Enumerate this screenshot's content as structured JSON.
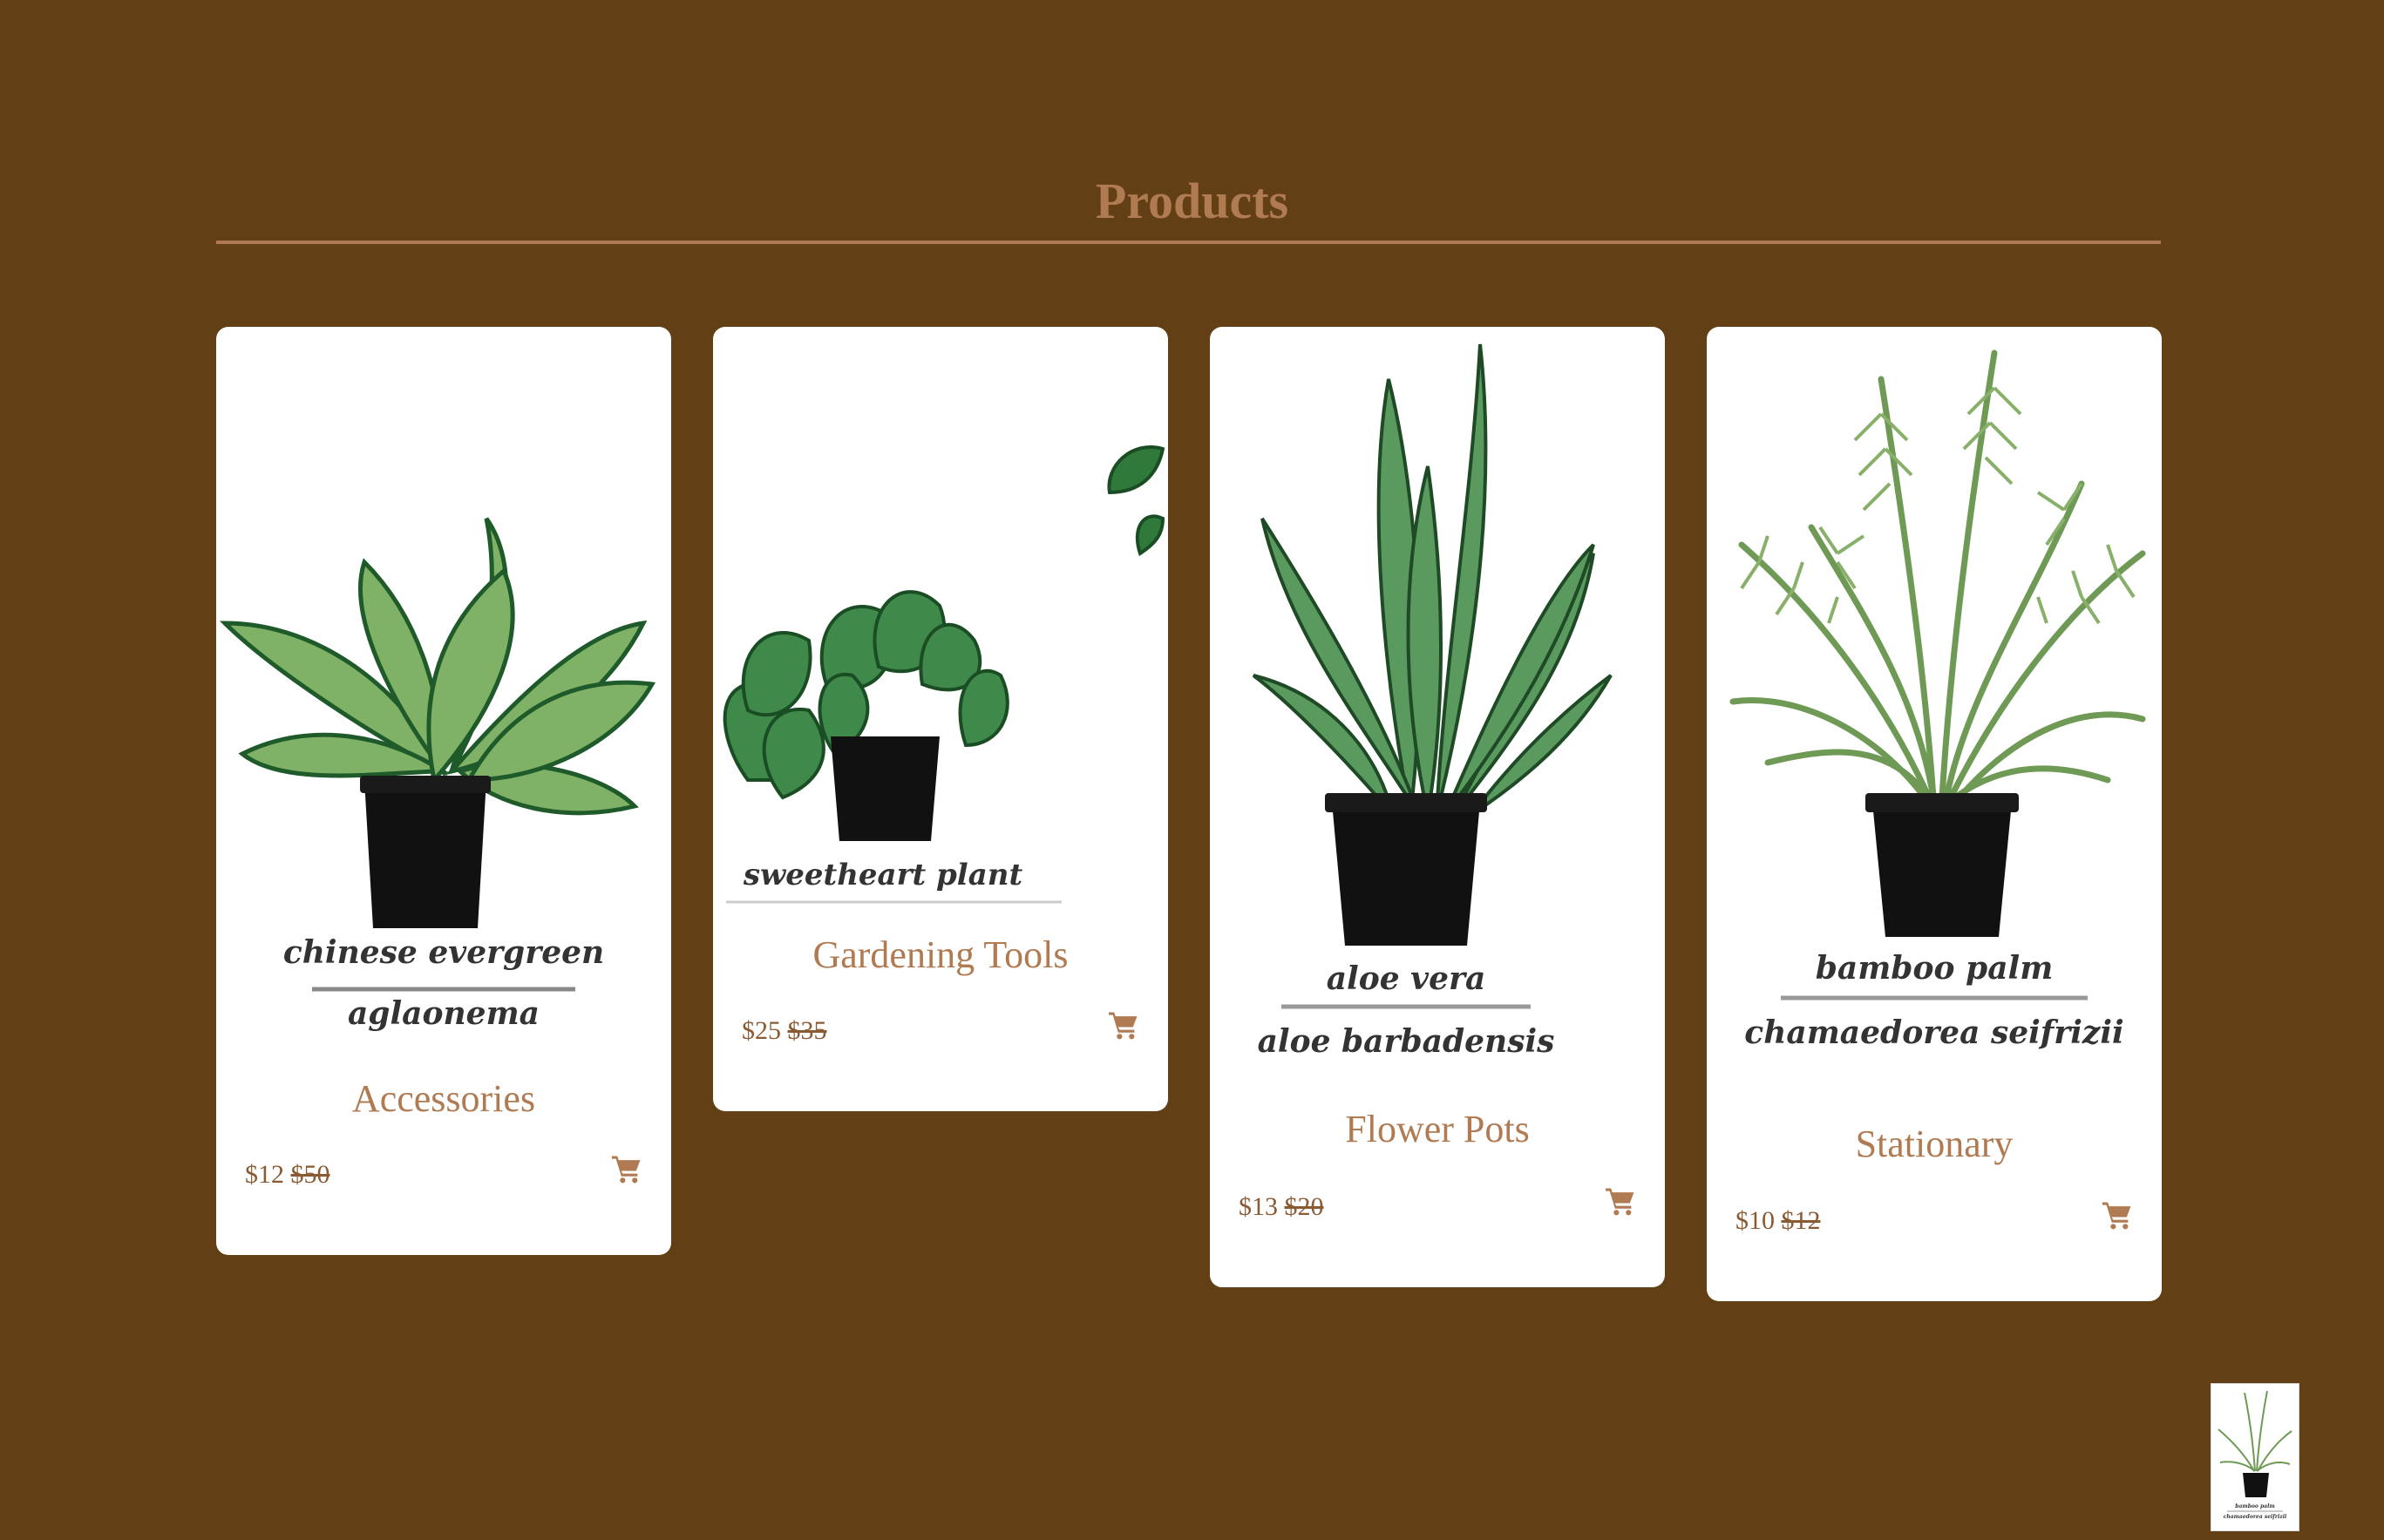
{
  "page": {
    "title": "Products"
  },
  "colors": {
    "background": "#623f14",
    "accent": "#b07b52",
    "card": "#ffffff"
  },
  "products": [
    {
      "name": "Accessories",
      "price": "$12",
      "old_price": "$50",
      "image_label_top": "chinese evergreen",
      "image_label_bottom": "aglaonema"
    },
    {
      "name": "Gardening Tools",
      "price": "$25",
      "old_price": "$35",
      "image_label_top": "sweetheart plant",
      "image_label_bottom": ""
    },
    {
      "name": "Flower Pots",
      "price": "$13",
      "old_price": "$20",
      "image_label_top": "aloe vera",
      "image_label_bottom": "aloe barbadensis"
    },
    {
      "name": "Stationary",
      "price": "$10",
      "old_price": "$12",
      "image_label_top": "bamboo palm",
      "image_label_bottom": "chamaedorea seifrizii"
    }
  ],
  "thumbnail": {
    "label_top": "bamboo palm",
    "label_bottom": "chamaedorea seifrizii"
  },
  "icons": {
    "cart": "shopping-cart-icon"
  }
}
